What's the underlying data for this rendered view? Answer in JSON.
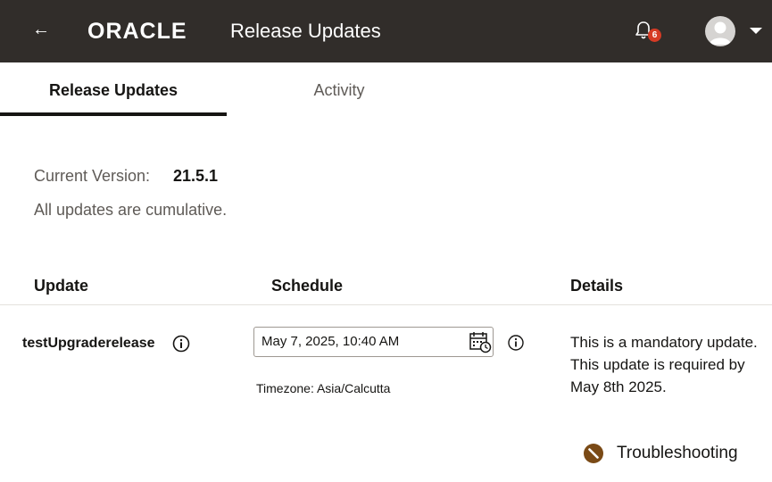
{
  "header": {
    "back_icon": "arrow-left-icon",
    "logo_text": "ORACLE",
    "title": "Release Updates",
    "notifications": {
      "icon": "bell-icon",
      "count": "6"
    },
    "avatar_icon": "user-avatar-icon",
    "menu_icon": "caret-down-icon",
    "background": "#312d2a"
  },
  "tabs": [
    {
      "label": "Release Updates",
      "active": true
    },
    {
      "label": "Activity",
      "active": false
    }
  ],
  "version": {
    "label": "Current Version:",
    "value": "21.5.1",
    "note": "All updates are cumulative."
  },
  "table": {
    "headers": {
      "update": "Update",
      "schedule": "Schedule",
      "details": "Details"
    },
    "rows": [
      {
        "update": "testUpgraderelease",
        "schedule_value": "May 7, 2025, 10:40 AM",
        "timezone": "Timezone: Asia/Calcutta",
        "details": "This is a mandatory update. This update is required by May 8th 2025.",
        "action_label": "Troubleshooting"
      }
    ]
  },
  "colors": {
    "accent_brown": "#7a4a16",
    "badge_red": "#d63b25"
  }
}
